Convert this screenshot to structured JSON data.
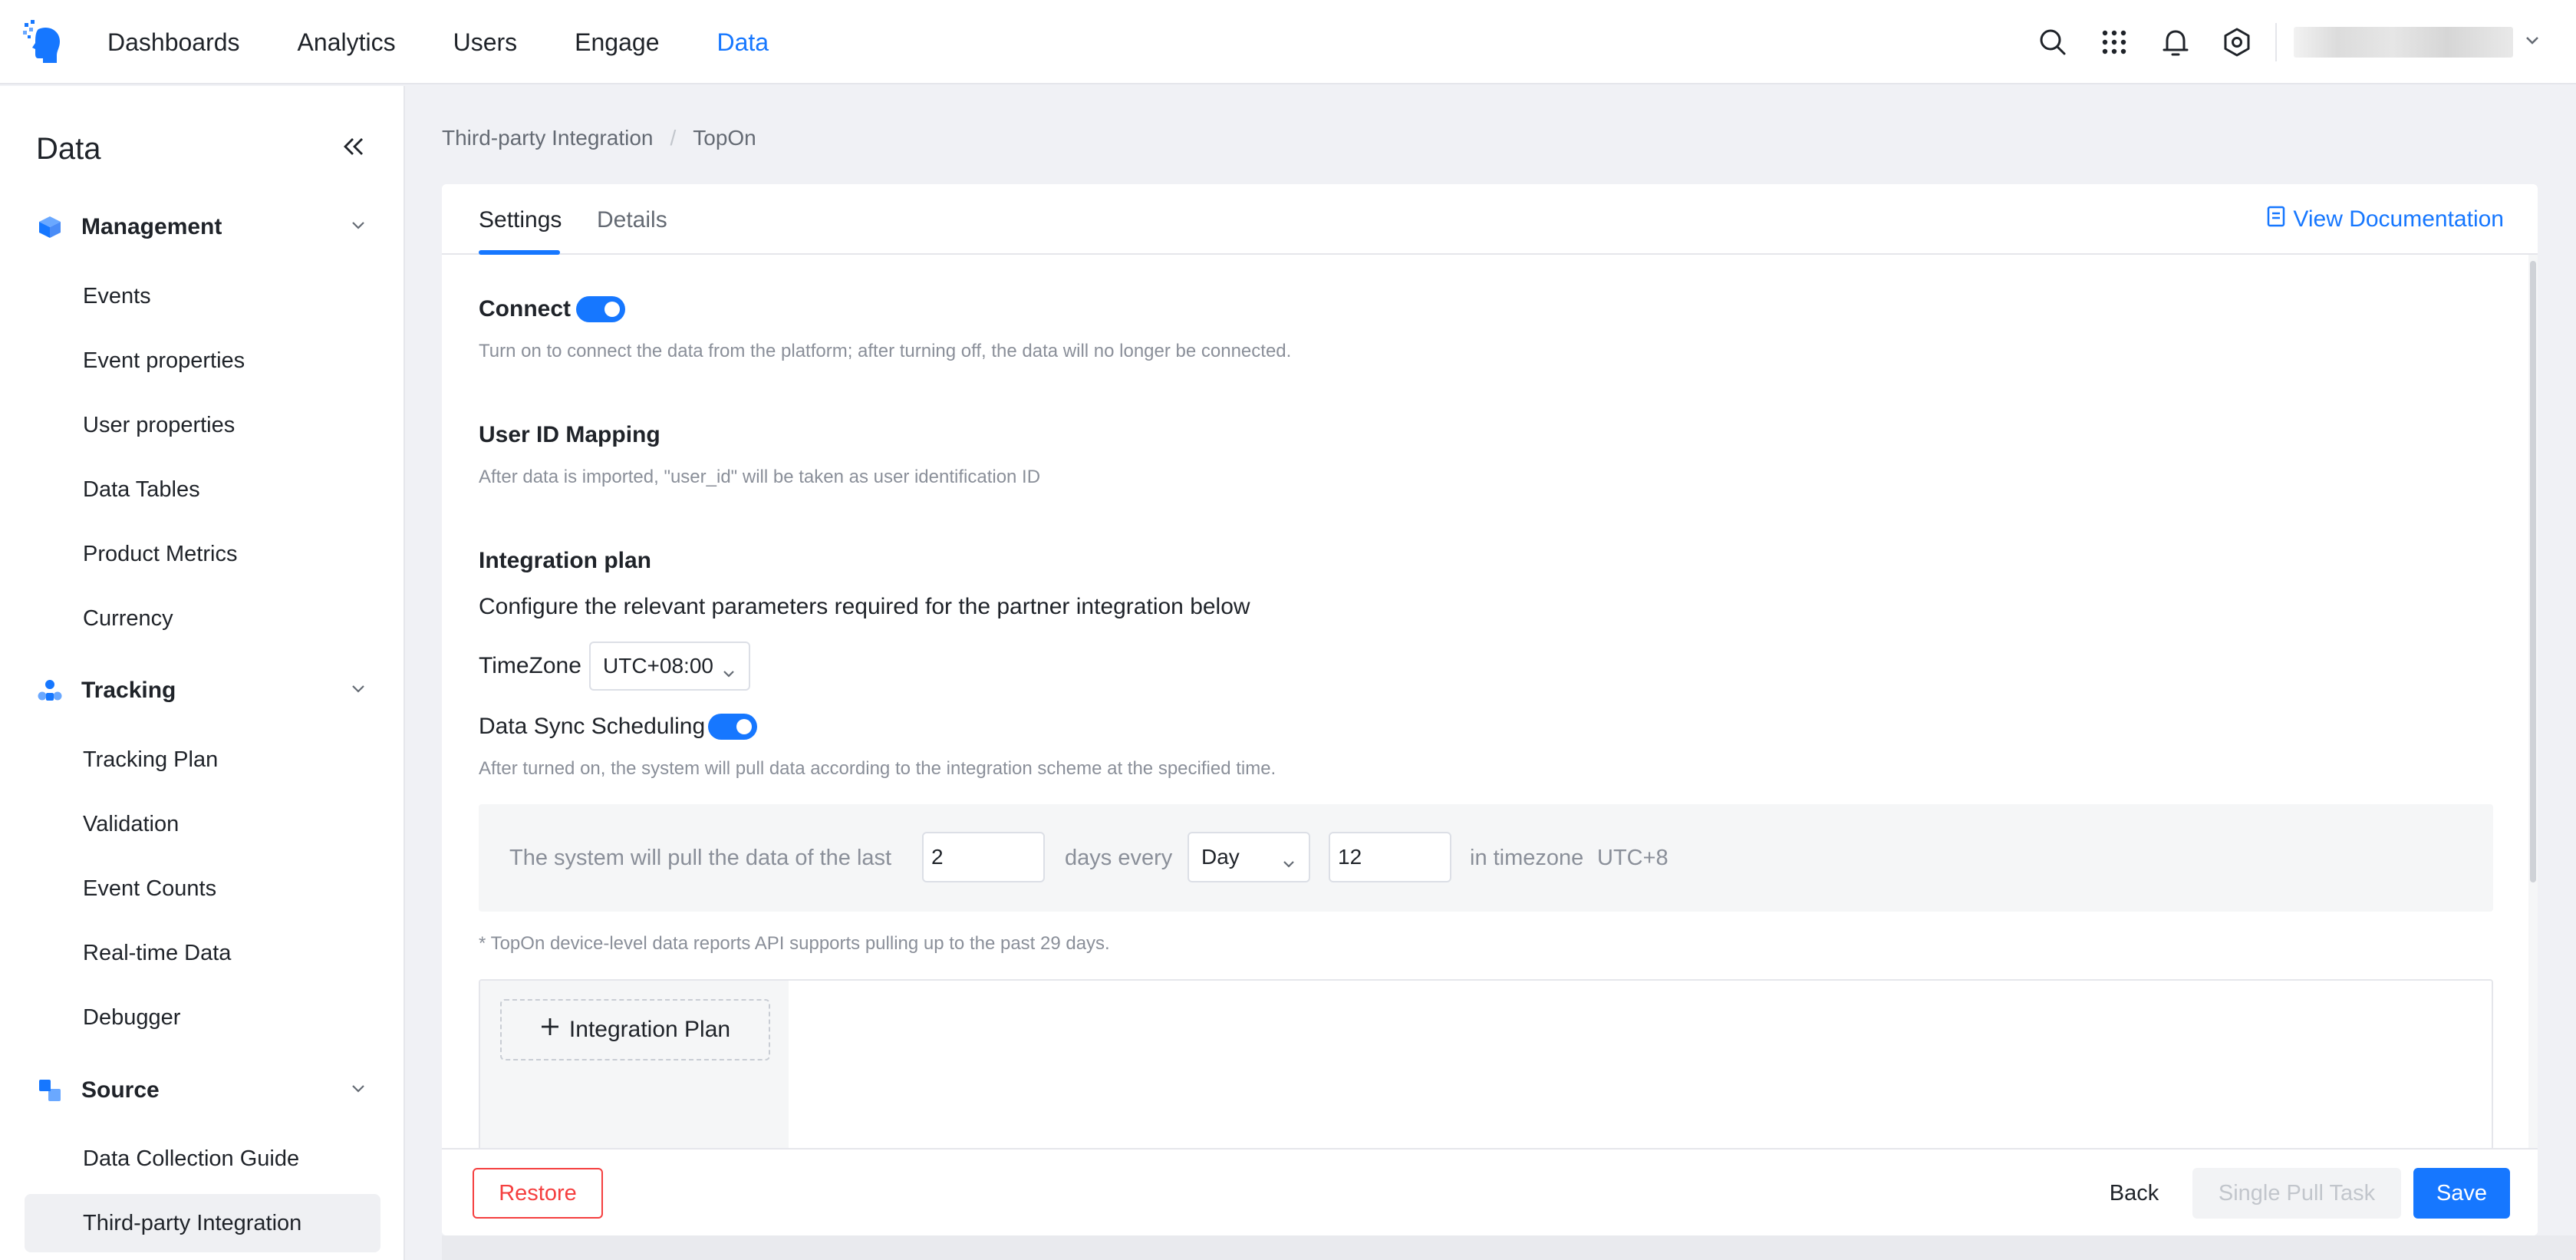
{
  "topnav": {
    "items": [
      {
        "label": "Dashboards"
      },
      {
        "label": "Analytics"
      },
      {
        "label": "Users"
      },
      {
        "label": "Engage"
      },
      {
        "label": "Data",
        "active": true
      }
    ],
    "icons": [
      "search-icon",
      "apps-grid-icon",
      "bell-icon",
      "settings-icon",
      "chevron-down-icon"
    ]
  },
  "sidebar": {
    "title": "Data",
    "groups": [
      {
        "label": "Management",
        "icon": "cube-icon",
        "items": [
          "Events",
          "Event properties",
          "User properties",
          "Data Tables",
          "Product Metrics",
          "Currency"
        ]
      },
      {
        "label": "Tracking",
        "icon": "tracking-icon",
        "items": [
          "Tracking Plan",
          "Validation",
          "Event Counts",
          "Real-time Data",
          "Debugger"
        ]
      },
      {
        "label": "Source",
        "icon": "source-icon",
        "items": [
          "Data Collection Guide",
          "Third-party Integration"
        ]
      }
    ],
    "active_item": "Third-party Integration"
  },
  "breadcrumb": {
    "parent": "Third-party Integration",
    "separator": "/",
    "current": "TopOn"
  },
  "tabs": {
    "settings": "Settings",
    "details": "Details",
    "active": "Settings"
  },
  "view_doc": "View Documentation",
  "connect": {
    "label": "Connect",
    "enabled": true,
    "hint": "Turn on to connect the data from the platform; after turning off, the data will no longer be connected."
  },
  "user_id_mapping": {
    "label": "User ID Mapping",
    "hint": "After data is imported, \"user_id\" will be taken as user identification ID"
  },
  "integration_plan": {
    "label": "Integration plan",
    "desc": "Configure the relevant parameters required for the partner integration below",
    "timezone_label": "TimeZone",
    "timezone_value": "UTC+08:00",
    "sync_label": "Data Sync Scheduling",
    "sync_enabled": true,
    "sync_hint": "After turned on, the system will pull data according to the integration scheme at the specified time.",
    "schedule": {
      "prefix": "The system will pull the data of the last",
      "days_value": "2",
      "mid": "days every",
      "period_value": "Day",
      "hour_value": "12",
      "suffix": "in timezone",
      "tz": "UTC+8"
    },
    "note": "* TopOn device-level data reports API supports pulling up to the past 29 days.",
    "add_plan": "Integration Plan"
  },
  "footer": {
    "restore": "Restore",
    "back": "Back",
    "single_pull": "Single Pull Task",
    "save": "Save"
  },
  "colors": {
    "accent": "#1677ff",
    "danger": "#f53f3f",
    "text": "#1f2329",
    "muted": "#8a8f99"
  }
}
